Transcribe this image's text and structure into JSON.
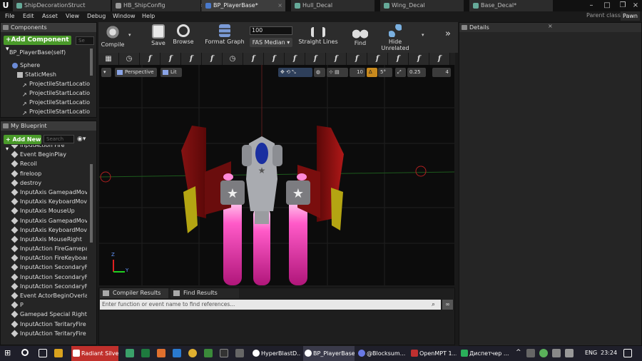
{
  "tabs": [
    {
      "label": "ShipDecorationStruct",
      "active": false
    },
    {
      "label": "HB_ShipConfig",
      "active": false
    },
    {
      "label": "BP_PlayerBase*",
      "active": true
    },
    {
      "label": "Hull_Decal",
      "active": false
    },
    {
      "label": "Wing_Decal",
      "active": false
    },
    {
      "label": "Base_Decal*",
      "active": false
    }
  ],
  "menu": [
    "File",
    "Edit",
    "Asset",
    "View",
    "Debug",
    "Window",
    "Help"
  ],
  "parent_class": {
    "label": "Parent class:",
    "value": "Pawn"
  },
  "components": {
    "title": "Components",
    "add_label": "+Add Component ▾",
    "search_placeholder": "Se",
    "root": "BP_PlayerBase(self)",
    "tree": [
      "Sphere",
      "StaticMesh",
      "ProjectileStartLocation",
      "ProjectileStartLocation",
      "ProjectileStartLocation",
      "ProjectileStartLocation"
    ]
  },
  "my_blueprint": {
    "title": "My Blueprint",
    "add_label": "+ Add New ▾",
    "search_placeholder": "Search",
    "items": [
      "InputAction Fire",
      "Event BeginPlay",
      "Recoil",
      "fireloop",
      "destroy",
      "InputAxis GamepadMove",
      "InputAxis KeyboardMove",
      "InputAxis MouseUp",
      "InputAxis GamepadMove",
      "InputAxis KeyboardMove",
      "InputAxis MouseRight",
      "InputAction FireGamepad",
      "InputAction FireKeyboard",
      "InputAction SecondaryF",
      "InputAction SecondaryF",
      "InputAction SecondaryF",
      "Event ActorBeginOverlap",
      "P",
      "Gamepad Special Right",
      "InputAction TeritaryFire",
      "InputAction TeritaryFire"
    ]
  },
  "toolbar": {
    "compile": "Compile",
    "save": "Save",
    "browse": "Browse",
    "format_graph": "Format Graph",
    "fas_value": "100",
    "fas_label": "FAS Median ▾",
    "straight_lines": "Straight Lines",
    "find": "Find",
    "hide_unrelated": "Hide Unrelated"
  },
  "details": {
    "title": "Details"
  },
  "viewport": {
    "perspective": "Perspective",
    "lit": "Lit",
    "grid_snap": "10",
    "rot_snap": "5°",
    "scale_snap": "0.25",
    "cam_speed": "4",
    "axis_z": "Z",
    "axis_y": "Y"
  },
  "compiler": {
    "tab_results": "Compiler Results",
    "tab_find": "Find Results",
    "find_placeholder": "Enter function or event name to find references..."
  },
  "taskbar": {
    "apps": [
      "Radiant Silve...",
      "HyperBlastD...",
      "BP_PlayerBase",
      "@Blocksum...",
      "OpenMPT 1....",
      "Диспетчер ..."
    ],
    "lang": "ENG",
    "time": "23:24"
  },
  "colors": {
    "accent_green": "#4a9a2a",
    "taskbar_red": "#c0302c",
    "exhaust_pink": "#ff5ac8"
  }
}
